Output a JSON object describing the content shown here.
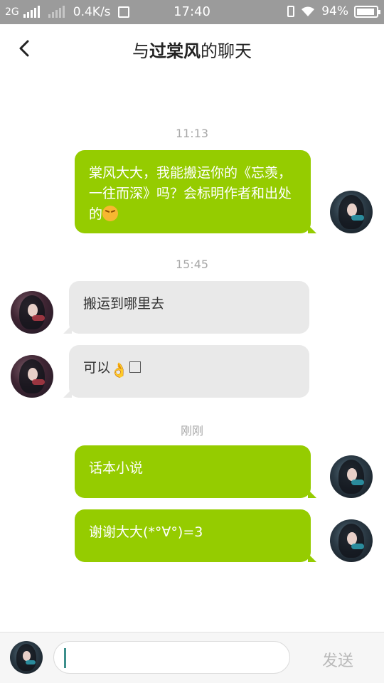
{
  "status_bar": {
    "network": "2G",
    "speed": "0.4K/s",
    "time": "17:40",
    "battery_percent": "94%",
    "battery_level": 0.94
  },
  "header": {
    "back_icon": "chevron-left-icon",
    "title_prefix": "与",
    "title_name": "过棠风",
    "title_suffix": "的聊天"
  },
  "messages": [
    {
      "time": "11:13"
    },
    {
      "side": "out",
      "text": "棠风大大，我能搬运你的《忘羡，一往而深》吗？会标明作者和出处的",
      "emoji": "angry-face-icon"
    },
    {
      "time": "15:45"
    },
    {
      "side": "in",
      "text": "搬运到哪里去"
    },
    {
      "side": "in",
      "text": "可以",
      "emoji": "ok-hand-icon"
    },
    {
      "time": "刚刚"
    },
    {
      "side": "out",
      "text": "话本小说"
    },
    {
      "side": "out",
      "text": "谢谢大大(*°∀°)=3"
    }
  ],
  "input_bar": {
    "placeholder": "",
    "send_label": "发送"
  },
  "colors": {
    "status_bar_bg": "#9b9b9b",
    "outgoing_bubble": "#95cc00",
    "incoming_bubble": "#e9e9e9",
    "timestamp_text": "#a8a8a8",
    "send_text": "#b9b9b9"
  }
}
